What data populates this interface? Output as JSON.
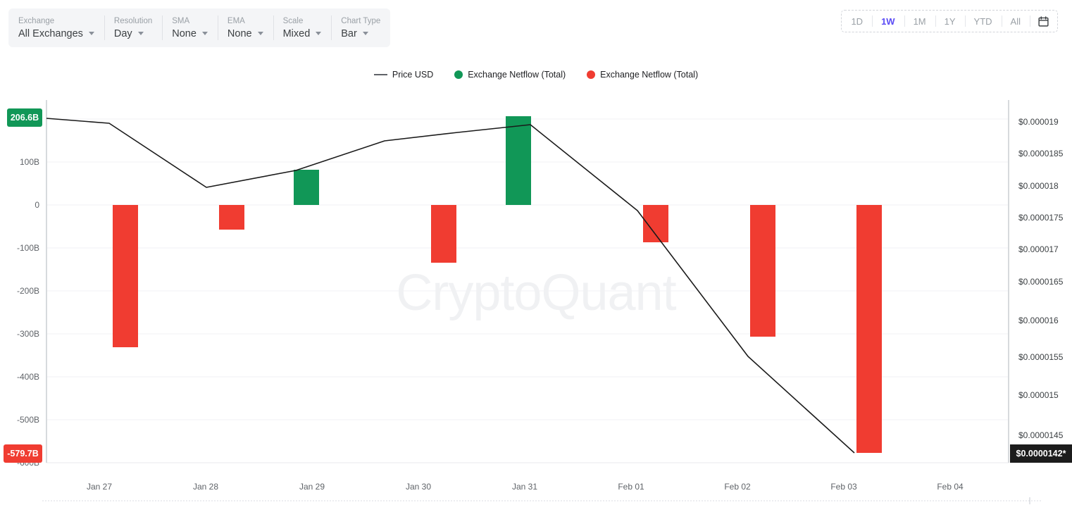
{
  "toolbar": {
    "controls": [
      {
        "label": "Exchange",
        "value": "All Exchanges"
      },
      {
        "label": "Resolution",
        "value": "Day"
      },
      {
        "label": "SMA",
        "value": "None"
      },
      {
        "label": "EMA",
        "value": "None"
      },
      {
        "label": "Scale",
        "value": "Mixed"
      },
      {
        "label": "Chart Type",
        "value": "Bar"
      }
    ],
    "ranges": [
      {
        "label": "1D",
        "active": false
      },
      {
        "label": "1W",
        "active": true
      },
      {
        "label": "1M",
        "active": false
      },
      {
        "label": "1Y",
        "active": false
      },
      {
        "label": "YTD",
        "active": false
      },
      {
        "label": "All",
        "active": false
      }
    ],
    "calendar_icon": "calendar-icon",
    "active_color": "#5b4cf5"
  },
  "legend": [
    {
      "type": "line",
      "label": "Price USD",
      "color": "#5f6368"
    },
    {
      "type": "dot",
      "label": "Exchange Netflow (Total)",
      "color": "#119757"
    },
    {
      "type": "dot",
      "label": "Exchange Netflow (Total)",
      "color": "#f03c31"
    }
  ],
  "watermark": "CryptoQuant",
  "colors": {
    "positive": "#119757",
    "negative": "#f03c31",
    "price_line": "#1a1a1a",
    "grid": "#f1f2f4",
    "badge_price": "#1c1c1c"
  },
  "badges": {
    "left_top": {
      "text": "206.6B",
      "color": "#119757"
    },
    "left_bottom": {
      "text": "-579.7B",
      "color": "#f03c31"
    },
    "right_bottom": {
      "text": "$0.0000142*",
      "color": "#1c1c1c"
    }
  },
  "chart_data": {
    "type": "bar",
    "title": "",
    "xlabel": "",
    "ylabel": "Exchange Netflow (Total)",
    "y2label": "Price USD",
    "grid": true,
    "legend_position": "top-center",
    "categories": [
      "Jan 27",
      "Jan 28",
      "Jan 29",
      "Jan 30",
      "Jan 31",
      "Feb 01",
      "Feb 02",
      "Feb 03",
      "Feb 04"
    ],
    "yticks_left": [
      "100B",
      "0",
      "-100B",
      "-200B",
      "-300B",
      "-400B",
      "-500B",
      "-600B"
    ],
    "ylim_left": [
      -620,
      230
    ],
    "yticks_right": [
      "$0.000019",
      "$0.0000185",
      "$0.000018",
      "$0.0000175",
      "$0.000017",
      "$0.0000165",
      "$0.000016",
      "$0.0000155",
      "$0.000015",
      "$0.0000145"
    ],
    "ylim_right": [
      1.41e-05,
      1.915e-05
    ],
    "series": [
      {
        "name": "Exchange Netflow (Total)",
        "type": "bar",
        "unit": "B",
        "values": [
          -330,
          -57,
          82,
          -135,
          207,
          -55,
          -307,
          -580,
          null
        ],
        "positive_color": "#119757",
        "negative_color": "#f03c31"
      },
      {
        "name": "Price USD",
        "type": "line",
        "unit": "USD",
        "color": "#1a1a1a",
        "values": [
          1.9e-05,
          1.78e-05,
          1.835e-05,
          1.868e-05,
          1.888e-05,
          1.747e-05,
          1.563e-05,
          1.42e-05,
          null
        ]
      }
    ],
    "annotations": [
      {
        "text": "206.6B",
        "axis": "left",
        "position": "top"
      },
      {
        "text": "-579.7B",
        "axis": "left",
        "position": "bottom"
      },
      {
        "text": "$0.0000142*",
        "axis": "right",
        "position": "bottom"
      }
    ]
  }
}
